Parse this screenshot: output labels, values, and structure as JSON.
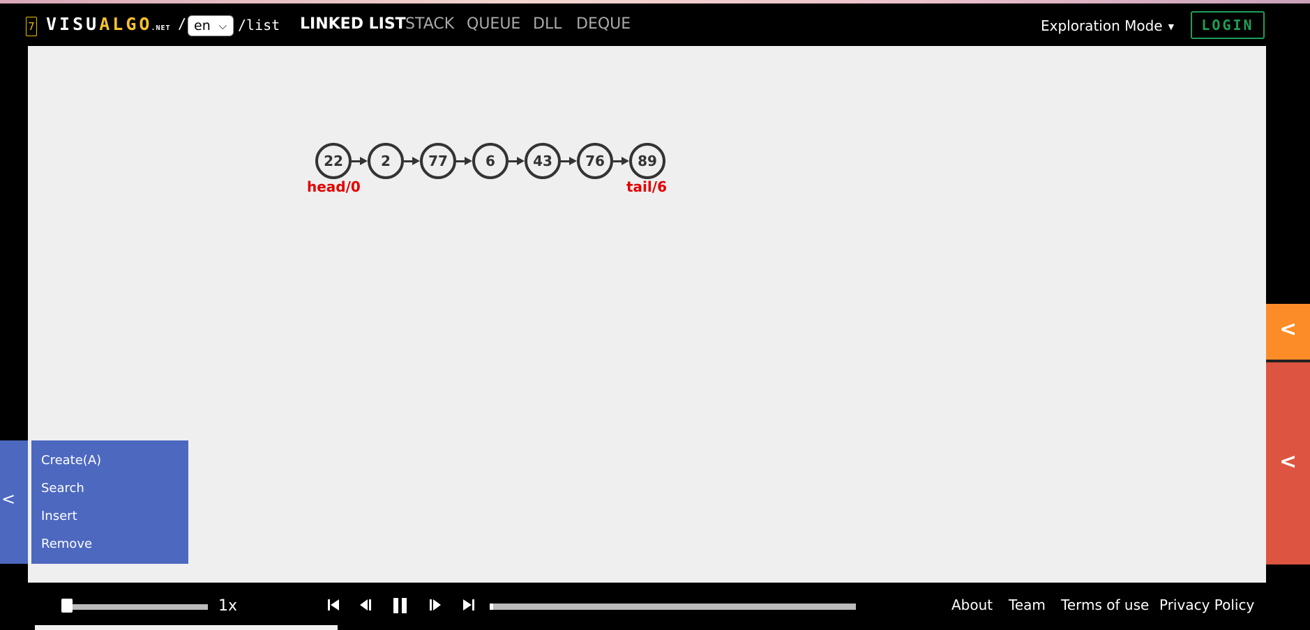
{
  "header": {
    "version_badge": "7",
    "logo_white_1": "VISU",
    "logo_yellow": "ALGO",
    "logo_net": ".NET",
    "slash": "/",
    "language": "en",
    "path": "/list",
    "nav": [
      "LINKED LIST",
      "STACK",
      "QUEUE",
      "DLL",
      "DEQUE"
    ],
    "active_nav": "LINKED LIST",
    "mode": "Exploration Mode",
    "login": "LOGIN"
  },
  "list": {
    "nodes": [
      "22",
      "2",
      "77",
      "6",
      "43",
      "76",
      "89"
    ],
    "head_label": "head/0",
    "tail_label": "tail/6"
  },
  "side_tab_label": "<",
  "menu": [
    "Create(A)",
    "Search",
    "Insert",
    "Remove"
  ],
  "right_tabs": {
    "orange_chevron": "<",
    "red_chevron": "<"
  },
  "playback": {
    "speed": "1x",
    "progress": 0.01,
    "controls": [
      "skip-to-start",
      "step-back",
      "pause",
      "step-forward",
      "skip-to-end"
    ]
  },
  "footer_links": [
    "About",
    "Team",
    "Terms of use",
    "Privacy Policy"
  ],
  "colors": {
    "accent_yellow": "#f6c22b",
    "login_green": "#1f9e57",
    "menu_blue": "#4d68bf",
    "tab_orange": "#fc8c27",
    "tab_red": "#dd5540",
    "label_red": "#e30000"
  }
}
